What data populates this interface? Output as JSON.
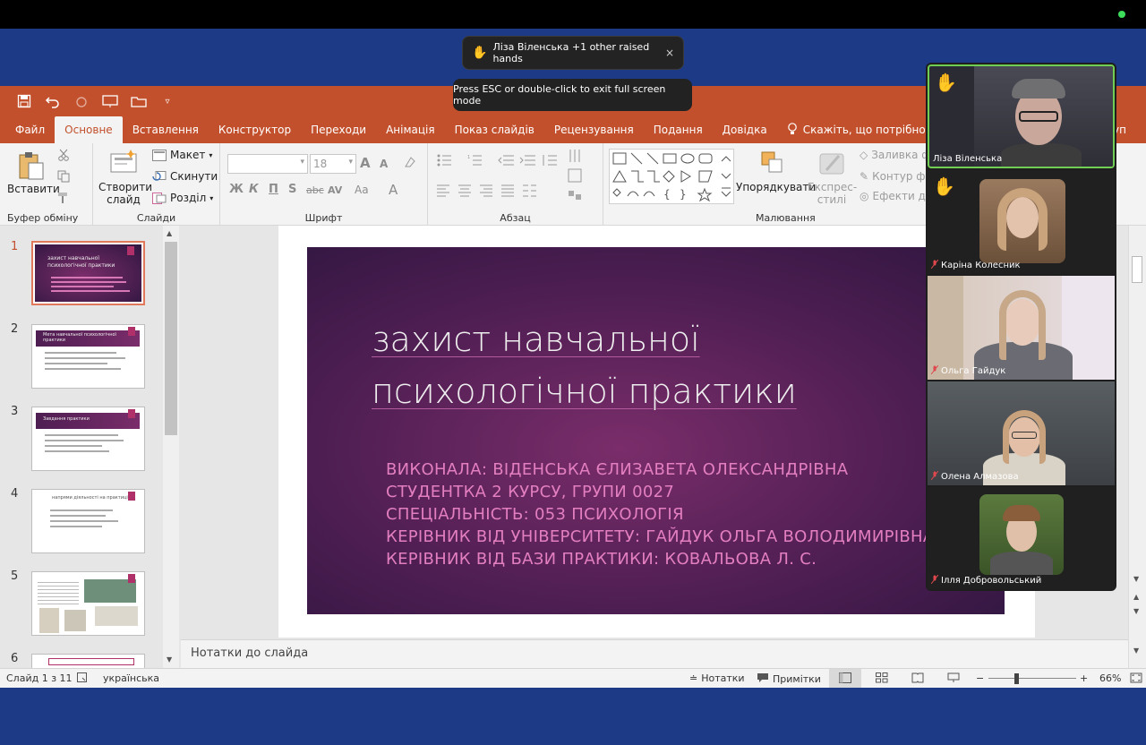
{
  "zoom_toast": {
    "hand_icon": "raised-hand-icon",
    "text": "Ліза Віленська +1 other raised hands",
    "close": "×"
  },
  "esc_hint": "Press ESC or double-click to exit full screen mode",
  "ribbon_tabs": [
    "Файл",
    "Основне",
    "Вставлення",
    "Конструктор",
    "Переходи",
    "Анімація",
    "Показ слайдів",
    "Рецензування",
    "Подання",
    "Довідка"
  ],
  "active_tab": "Основне",
  "tell_me": "Скажіть, що потрібно зробити",
  "share_partial": "уп",
  "ribbon": {
    "clipboard": {
      "paste": "Вставити",
      "label": "Буфер обміну"
    },
    "slides": {
      "new_slide_line1": "Створити",
      "new_slide_line2": "слайд",
      "layout": "Макет",
      "reset": "Скинути",
      "section": "Розділ",
      "label": "Слайди"
    },
    "font": {
      "size": "18",
      "bold": "Ж",
      "italic": "К",
      "underline": "П",
      "shadow": "S",
      "strike": "abc",
      "spacing": "AV",
      "case": "Aa",
      "color": "A",
      "grow": "A",
      "shrink": "A",
      "label": "Шрифт"
    },
    "paragraph": {
      "label": "Абзац"
    },
    "drawing": {
      "arrange": "Упорядкувати",
      "quick_styles_line1": "Експрес-",
      "quick_styles_line2": "стилі",
      "fill": "Заливка фі",
      "outline": "Контур фі",
      "effects": "Ефекти для",
      "label": "Малювання"
    }
  },
  "slide_numbers": [
    "1",
    "2",
    "3",
    "4",
    "5",
    "6"
  ],
  "thumbnails": [
    {
      "title": "захист навчальної психологічної практики"
    },
    {
      "title": "Мета навчальної психологічної практики"
    },
    {
      "title": "Завдання практики"
    },
    {
      "title": "напрями діяльності на практиці"
    },
    {
      "title": ""
    },
    {
      "title": ""
    }
  ],
  "slide": {
    "title_line1": "захист навчальної",
    "title_line2": "психологічної практики",
    "body": [
      "ВИКОНАЛА: ВІДЕНСЬКА ЄЛИЗАВЕТА ОЛЕКСАНДРІВНА",
      "СТУДЕНТКА 2 КУРСУ, ГРУПИ 0027",
      "СПЕЦІАЛЬНІСТЬ: 053 ПСИХОЛОГІЯ",
      "КЕРІВНИК ВІД УНІВЕРСИТЕТУ: ГАЙДУК ОЛЬГА ВОЛОДИМИРІВНА",
      "КЕРІВНИК ВІД БАЗИ ПРАКТИКИ: КОВАЛЬОВА Л. С."
    ]
  },
  "notes_placeholder": "Нотатки до слайда",
  "status": {
    "slide_counter": "Слайд 1 з 11",
    "language": "українська",
    "notes_btn": "Нотатки",
    "comments_btn": "Примітки",
    "zoom_minus": "−",
    "zoom_plus": "+",
    "zoom": "66%"
  },
  "participants": [
    {
      "name": "Ліза Віленська",
      "raised_hand": true,
      "muted": false,
      "speaking": true
    },
    {
      "name": "Каріна Колесник",
      "raised_hand": true,
      "muted": true,
      "speaking": false
    },
    {
      "name": "Ольга Гайдук",
      "raised_hand": false,
      "muted": true,
      "speaking": false
    },
    {
      "name": "Олена Алмазова",
      "raised_hand": false,
      "muted": true,
      "speaking": false
    },
    {
      "name": "Ілля Добровольський",
      "raised_hand": false,
      "muted": true,
      "speaking": false
    }
  ],
  "colors": {
    "ppt_accent": "#c3502c",
    "zoom_bg": "#1c3a86",
    "slide_text_pink": "#e37fc0",
    "speaking_border": "#6fce53"
  }
}
